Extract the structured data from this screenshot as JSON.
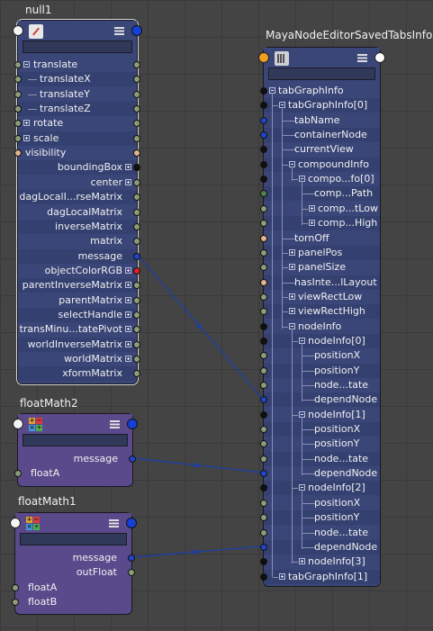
{
  "nodes": {
    "null1": {
      "title": "null1",
      "attributes": [
        {
          "label": "translate",
          "side": "in",
          "expander": "minus"
        },
        {
          "label": "translateX",
          "side": "in"
        },
        {
          "label": "translateY",
          "side": "in"
        },
        {
          "label": "translateZ",
          "side": "in"
        },
        {
          "label": "rotate",
          "side": "in",
          "expander": "plus"
        },
        {
          "label": "scale",
          "side": "in",
          "expander": "plus"
        },
        {
          "label": "visibility",
          "side": "in"
        },
        {
          "label": "boundingBox",
          "side": "out",
          "expander": "plus"
        },
        {
          "label": "center",
          "side": "out",
          "expander": "plus"
        },
        {
          "label": "dagLocalI...rseMatrix",
          "side": "out"
        },
        {
          "label": "dagLocalMatrix",
          "side": "out"
        },
        {
          "label": "inverseMatrix",
          "side": "out"
        },
        {
          "label": "matrix",
          "side": "out"
        },
        {
          "label": "message",
          "side": "out"
        },
        {
          "label": "objectColorRGB",
          "side": "out",
          "expander": "plus"
        },
        {
          "label": "parentInverseMatrix",
          "side": "out",
          "expander": "plus"
        },
        {
          "label": "parentMatrix",
          "side": "out",
          "expander": "plus"
        },
        {
          "label": "selectHandle",
          "side": "out",
          "expander": "plus"
        },
        {
          "label": "transMinu...tatePivot",
          "side": "out",
          "expander": "plus"
        },
        {
          "label": "worldInverseMatrix",
          "side": "out",
          "expander": "plus"
        },
        {
          "label": "worldMatrix",
          "side": "out",
          "expander": "plus"
        },
        {
          "label": "xformMatrix",
          "side": "out"
        }
      ]
    },
    "floatMath2": {
      "title": "floatMath2",
      "attributes": [
        {
          "label": "message",
          "side": "out"
        },
        {
          "label": "floatA",
          "side": "in"
        }
      ]
    },
    "floatMath1": {
      "title": "floatMath1",
      "attributes": [
        {
          "label": "message",
          "side": "out"
        },
        {
          "label": "outFloat",
          "side": "out"
        },
        {
          "label": "floatA",
          "side": "in"
        },
        {
          "label": "floatB",
          "side": "in"
        }
      ]
    },
    "tabs": {
      "title": "MayaNodeEditorSavedTabsInfo",
      "attributes": [
        {
          "label": "tabGraphInfo",
          "depth": 0,
          "expander": "minus"
        },
        {
          "label": "tabGraphInfo[0]",
          "depth": 1,
          "expander": "minus"
        },
        {
          "label": "tabName",
          "depth": 2
        },
        {
          "label": "containerNode",
          "depth": 2
        },
        {
          "label": "currentView",
          "depth": 2
        },
        {
          "label": "compoundInfo",
          "depth": 2,
          "expander": "minus"
        },
        {
          "label": "compo...fo[0]",
          "depth": 3,
          "expander": "minus"
        },
        {
          "label": "comp...Path",
          "depth": 4
        },
        {
          "label": "comp...tLow",
          "depth": 4,
          "expander": "plus"
        },
        {
          "label": "comp...High",
          "depth": 4,
          "expander": "plus"
        },
        {
          "label": "tornOff",
          "depth": 2
        },
        {
          "label": "panelPos",
          "depth": 2,
          "expander": "plus"
        },
        {
          "label": "panelSize",
          "depth": 2,
          "expander": "plus"
        },
        {
          "label": "hasInte...lLayout",
          "depth": 2
        },
        {
          "label": "viewRectLow",
          "depth": 2,
          "expander": "plus"
        },
        {
          "label": "viewRectHigh",
          "depth": 2,
          "expander": "plus"
        },
        {
          "label": "nodeInfo",
          "depth": 2,
          "expander": "minus"
        },
        {
          "label": "nodeInfo[0]",
          "depth": 3,
          "expander": "minus"
        },
        {
          "label": "positionX",
          "depth": 4
        },
        {
          "label": "positionY",
          "depth": 4
        },
        {
          "label": "node...tate",
          "depth": 4
        },
        {
          "label": "dependNode",
          "depth": 4
        },
        {
          "label": "nodeInfo[1]",
          "depth": 3,
          "expander": "minus"
        },
        {
          "label": "positionX",
          "depth": 4
        },
        {
          "label": "positionY",
          "depth": 4
        },
        {
          "label": "node...tate",
          "depth": 4
        },
        {
          "label": "dependNode",
          "depth": 4
        },
        {
          "label": "nodeInfo[2]",
          "depth": 3,
          "expander": "minus"
        },
        {
          "label": "positionX",
          "depth": 4
        },
        {
          "label": "positionY",
          "depth": 4
        },
        {
          "label": "node...tate",
          "depth": 4
        },
        {
          "label": "dependNode",
          "depth": 4
        },
        {
          "label": "nodeInfo[3]",
          "depth": 3,
          "expander": "plus"
        },
        {
          "label": "tabGraphInfo[1]",
          "depth": 1,
          "expander": "plus"
        }
      ]
    }
  },
  "colors": {
    "canvas": "#444444",
    "transform_node_body": "#3b4678",
    "transform_row_alt": "#344070",
    "floatmath_node_body": "#5a4a8c",
    "wire": "#1f3fa0",
    "port_matrix": "#8a9c78",
    "port_message": "#2144c8",
    "port_bool": "#e2b48e",
    "port_compound": "#101010",
    "port_color": "#e02020",
    "port_string": "#4e7f4f"
  }
}
